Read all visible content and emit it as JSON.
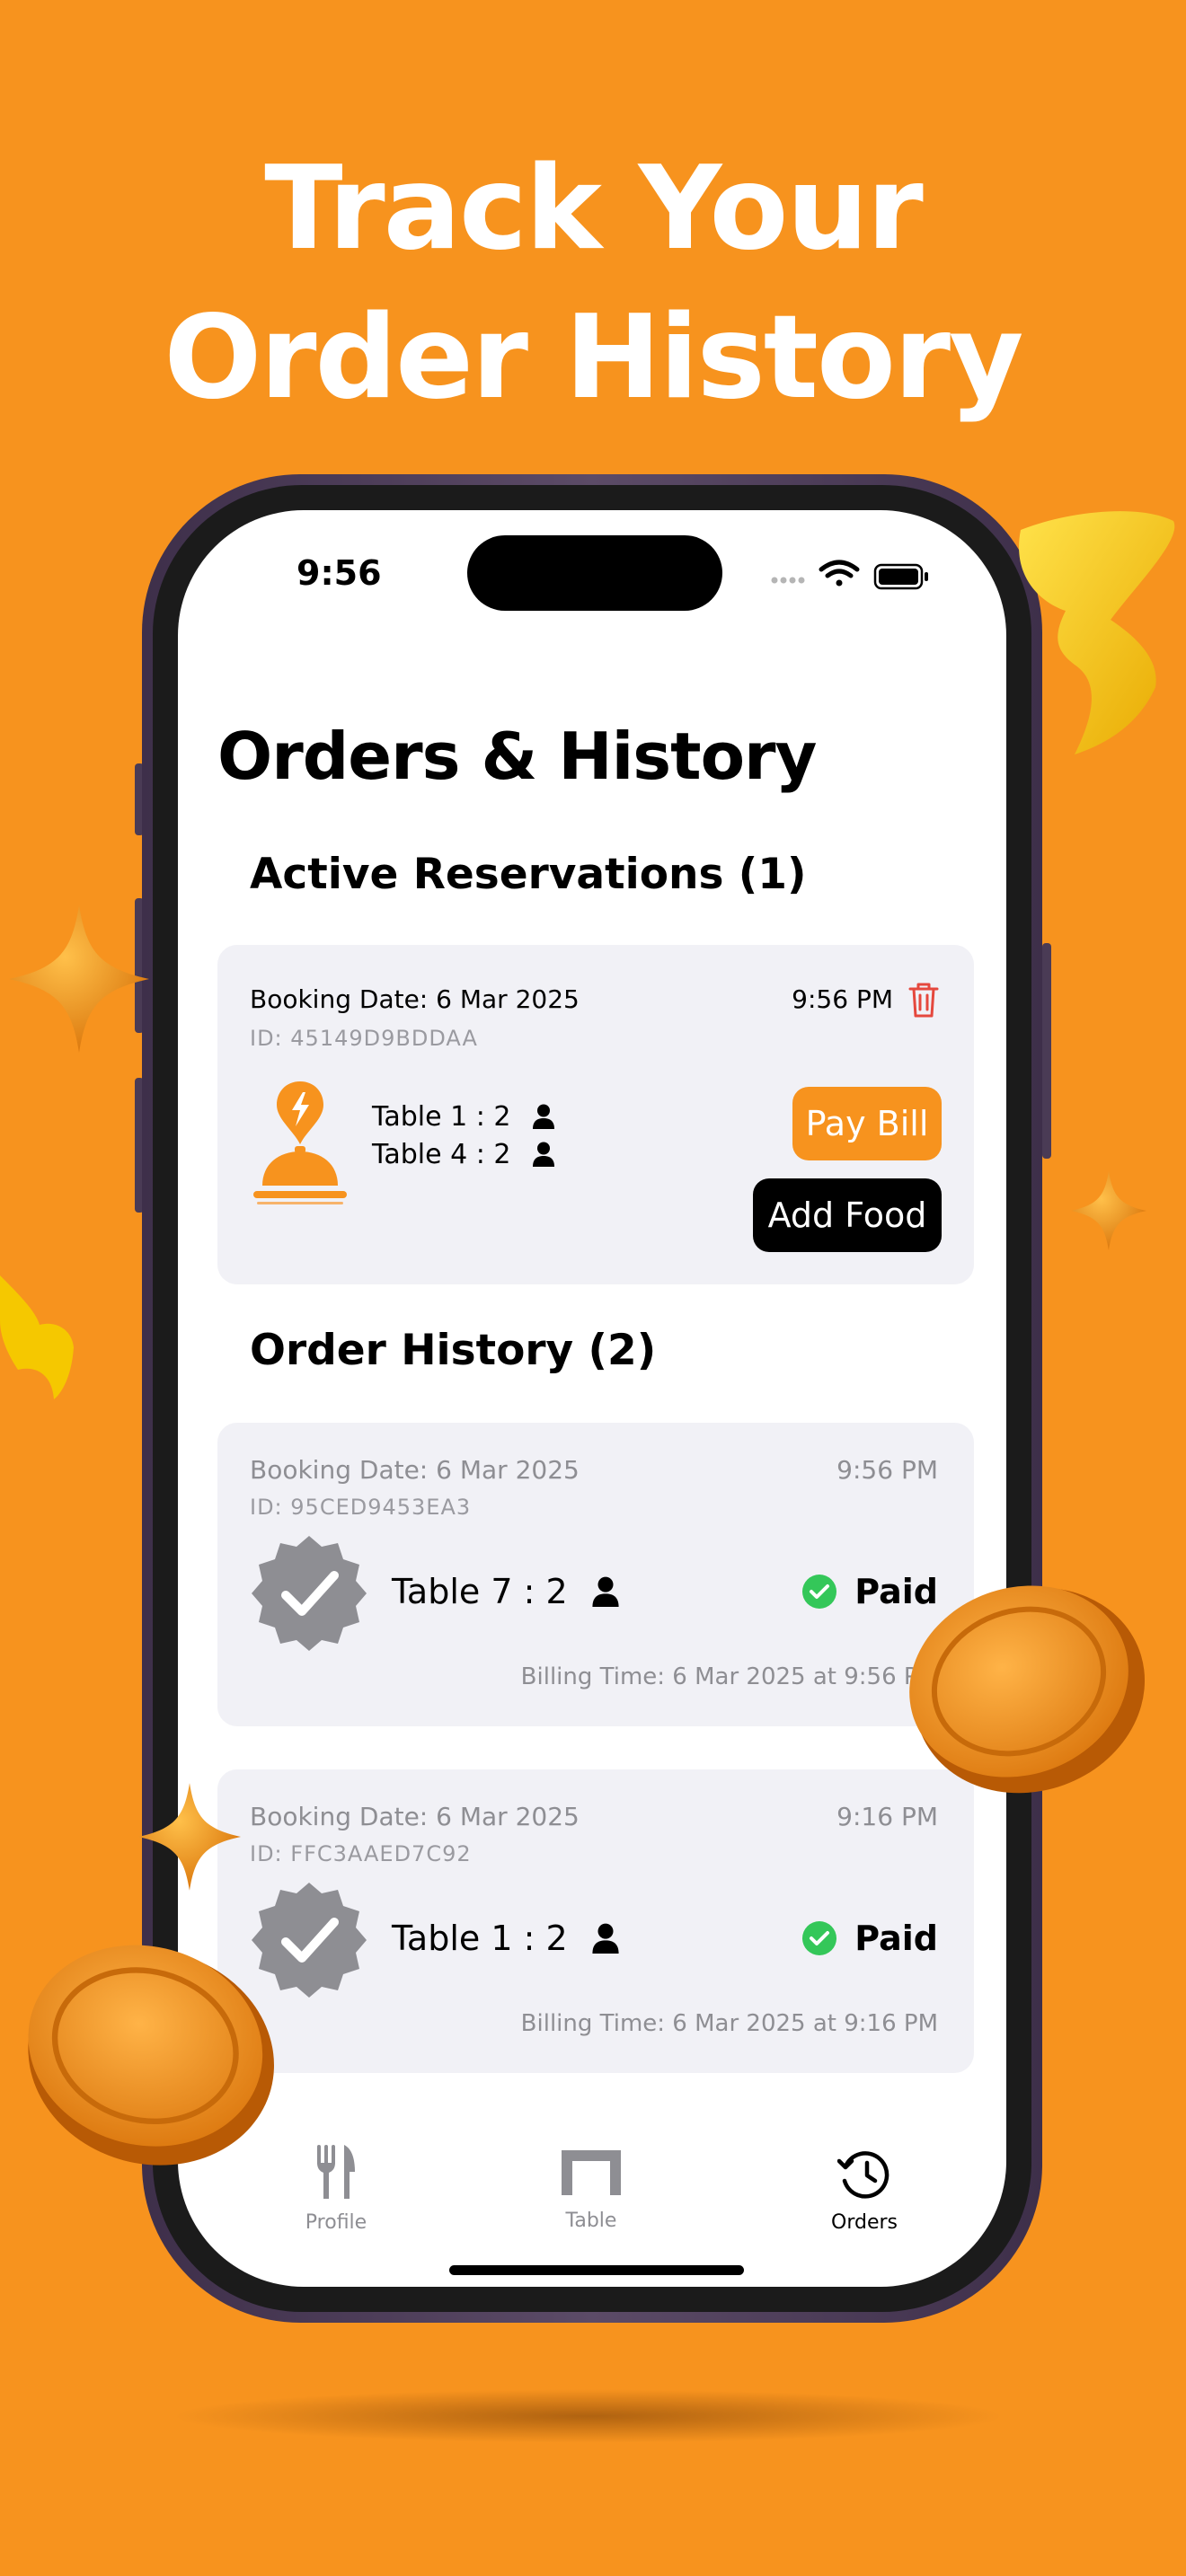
{
  "headline": {
    "line1": "Track Your",
    "line2": "Order History"
  },
  "status_bar": {
    "time": "9:56"
  },
  "page": {
    "title": "Orders & History"
  },
  "active_section": {
    "title": "Active Reservations (1)",
    "card": {
      "booking_date": "Booking Date: 6 Mar 2025",
      "id": "ID: 45149D9BDDAA",
      "time": "9:56 PM",
      "tables": [
        "Table 1 : 2",
        "Table 4 : 2"
      ],
      "pay_label": "Pay Bill",
      "add_food_label": "Add Food"
    }
  },
  "history_section": {
    "title": "Order History (2)",
    "orders": [
      {
        "booking_date": "Booking Date: 6 Mar 2025",
        "id": "ID: 95CED9453EA3",
        "time": "9:56 PM",
        "table": "Table 7 : 2",
        "status": "Paid",
        "billing": "Billing Time: 6 Mar 2025 at 9:56 PM"
      },
      {
        "booking_date": "Booking Date: 6 Mar 2025",
        "id": "ID: FFC3AAED7C92",
        "time": "9:16 PM",
        "table": "Table 1 : 2",
        "status": "Paid",
        "billing": "Billing Time: 6 Mar 2025 at 9:16 PM"
      }
    ]
  },
  "tabbar": {
    "tabs": [
      {
        "label": "Profile",
        "icon": "fork-knife-icon"
      },
      {
        "label": "Table",
        "icon": "table-icon"
      },
      {
        "label": "Orders",
        "icon": "clock-history-icon",
        "active": true
      }
    ]
  },
  "colors": {
    "background": "#F7931E",
    "accent": "#F7931E",
    "delete": "#E5483D",
    "paid": "#34C759",
    "badge": "#8E8E93"
  }
}
